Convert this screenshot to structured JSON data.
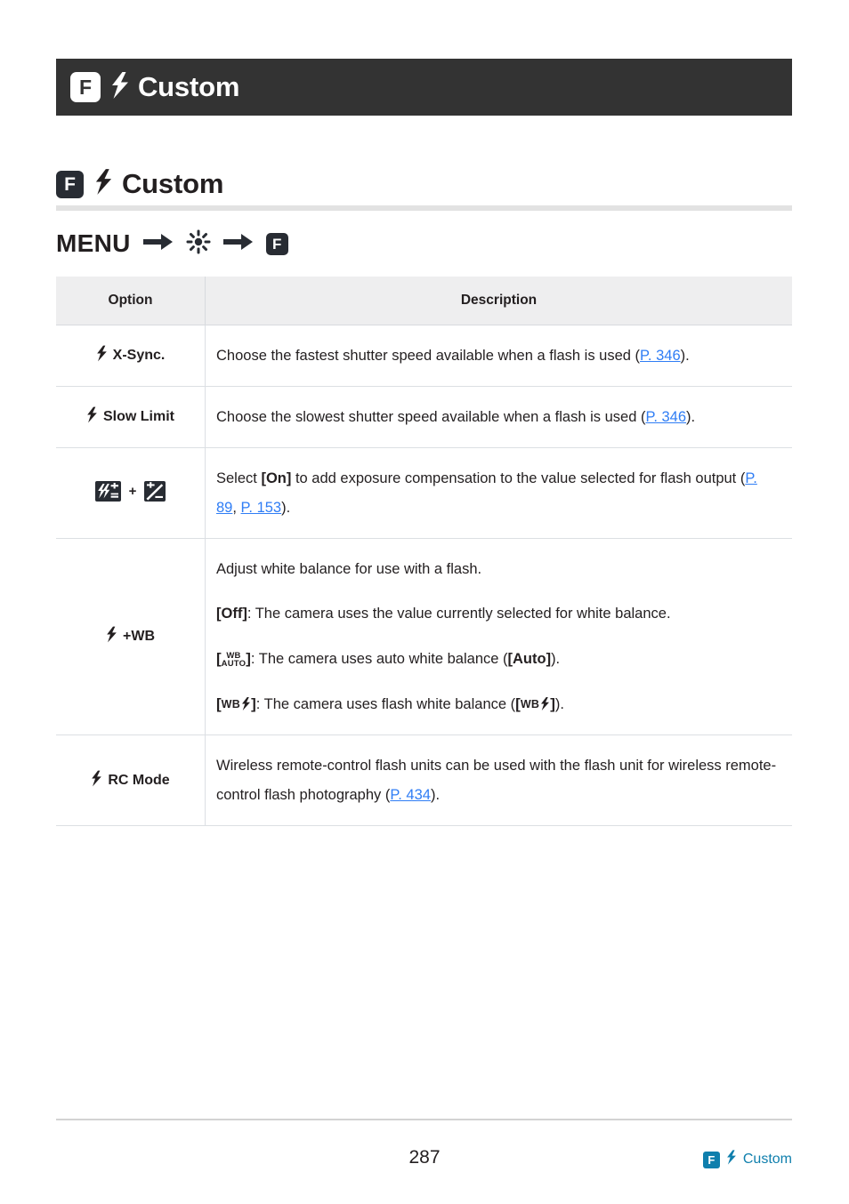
{
  "running_header": {
    "badge": "F",
    "badge_icon": "f-badge-icon",
    "flash_icon": "flash-bolt-icon",
    "title": "Custom"
  },
  "page_title": {
    "badge": "F",
    "flash_icon": "flash-bolt-icon",
    "text": "Custom"
  },
  "menu_path": {
    "menu_label": "MENU",
    "arrow_icon": "arrow-right-icon",
    "gear_icon": "custom-menu-gear-icon",
    "badge": "F"
  },
  "table": {
    "headers": {
      "option": "Option",
      "description": "Description"
    },
    "rows": [
      {
        "option_icon": "flash-bolt-icon",
        "option": "X-Sync.",
        "description_parts": [
          {
            "text": "Choose the fastest shutter speed available when a flash is used ("
          },
          {
            "text": "P. 346",
            "link": true
          },
          {
            "text": ")."
          }
        ]
      },
      {
        "option_icon": "flash-bolt-icon",
        "option": "Slow Limit",
        "description_parts": [
          {
            "text": "Choose the slowest shutter speed available when a flash is used ("
          },
          {
            "text": "P. 346",
            "link": true
          },
          {
            "text": ")."
          }
        ]
      },
      {
        "option_icon": "flash-exposure-compensation-icon",
        "option_icon_2": "exposure-compensation-icon",
        "option": "",
        "option_separator": "+",
        "description_parts": [
          {
            "text": "Select "
          },
          {
            "text": "[On]",
            "bold": true
          },
          {
            "text": " to add exposure compensation to the value selected for flash output ("
          },
          {
            "text": "P. 89",
            "link": true
          },
          {
            "text": ", "
          },
          {
            "text": "P. 153",
            "link": true
          },
          {
            "text": ")."
          }
        ]
      },
      {
        "option_icon": "flash-bolt-icon",
        "option": "+WB",
        "paragraphs": [
          "Adjust white balance for use with a flash.",
          "[Off]: The camera uses the value currently selected for white balance.",
          "[WB AUTO]: The camera uses auto white balance ([Auto]).",
          "[WB flash]: The camera uses flash white balance ([WB flash])."
        ],
        "p2_bold": "[Off]",
        "p2_rest": ": The camera uses the value currently selected for white balance.",
        "p3_glyph_line1": "WB",
        "p3_glyph_line2": "AUTO",
        "p3_rest": ": The camera uses auto white balance (",
        "p3_auto": "[Auto]",
        "p3_tail": ").",
        "p4_glyph": "WB",
        "p4_rest": ": The camera uses flash white balance (",
        "p4_tail": ")."
      },
      {
        "option_icon": "flash-bolt-icon",
        "option": "RC Mode",
        "description_parts": [
          {
            "text": "Wireless remote-control flash units can be used with the flash unit for wireless remote-control flash photography ("
          },
          {
            "text": "P. 434",
            "link": true
          },
          {
            "text": ")."
          }
        ]
      }
    ]
  },
  "footer": {
    "page_number": "287",
    "badge": "F",
    "flash_icon": "flash-bolt-icon",
    "link_text": "Custom"
  },
  "colors": {
    "header_bar": "#333333",
    "badge_dark": "#282c33",
    "link_blue": "#2f7df5",
    "footer_teal": "#0f7fad",
    "table_header_bg": "#eeeeef",
    "rule_gray": "#e2e2e2"
  }
}
